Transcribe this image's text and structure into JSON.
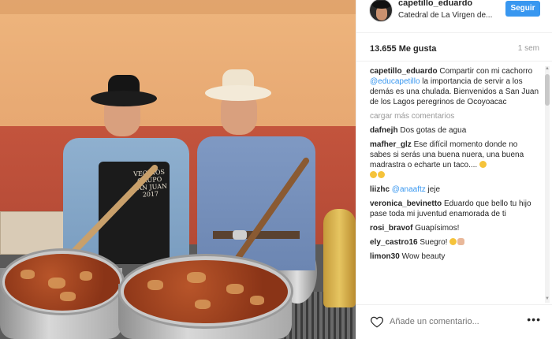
{
  "header": {
    "username": "capetillo_eduardo",
    "location": "Catedral de La Virgen de...",
    "follow_label": "Seguir"
  },
  "stats": {
    "likes": "13.655 Me gusta",
    "time": "1 sem"
  },
  "caption": {
    "user": "capetillo_eduardo",
    "text_before": "Compartir con mi cachorro ",
    "mention": "@educapetillo",
    "text_after": " la importancia de servir a los demás es una chulada. Bienvenidos a San Juan de los Lagos peregrinos de Ocoyoacac"
  },
  "load_more": "cargar más comentarios",
  "comments": [
    {
      "user": "dafnejh",
      "text": "Dos gotas de agua"
    },
    {
      "user": "mafher_glz",
      "text": "Ese difícil momento donde no sabes si serás una buena nuera, una buena madrastra o echarte un taco.... "
    },
    {
      "user": "liizhc",
      "mention": "@anaaftz",
      "text": " jeje"
    },
    {
      "user": "veronica_bevinetto",
      "text": "Eduardo que bello tu hijo pase toda mi juventud enamorada de ti"
    },
    {
      "user": "rosi_bravof",
      "text": "Guapísimos!"
    },
    {
      "user": "ely_castro16",
      "text": "Suegro!"
    },
    {
      "user": "limon30",
      "text": "Wow beauty"
    }
  ],
  "photo": {
    "apron_text": "VECINOS GRUPO SAN JUAN 2017"
  },
  "footer": {
    "comment_placeholder": "Añade un comentario...",
    "more_label": "•••"
  },
  "icons": {
    "heart": "heart-icon",
    "more": "more-options-icon"
  },
  "colors": {
    "accent": "#3897f0",
    "wall_red": "#b44a36",
    "wall_peach": "#eeb57d"
  }
}
